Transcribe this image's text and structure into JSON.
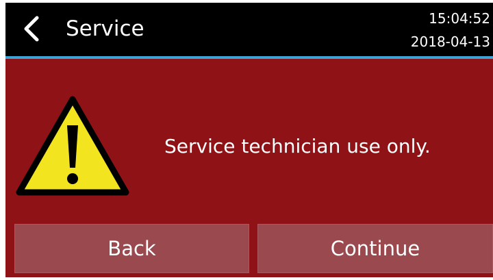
{
  "header": {
    "title": "Service",
    "back_icon": "chevron-left-icon",
    "time": "15:04:52",
    "date": "2018-04-13"
  },
  "main": {
    "warning_icon": "warning-triangle-icon",
    "message": "Service technician use only."
  },
  "buttons": {
    "back_label": "Back",
    "continue_label": "Continue"
  },
  "colors": {
    "header_bg": "#000000",
    "accent_line": "#3ba3d6",
    "screen_bg": "#8f1217",
    "button_bg": "#9a4a4f",
    "warning_yellow": "#f2e51f"
  }
}
